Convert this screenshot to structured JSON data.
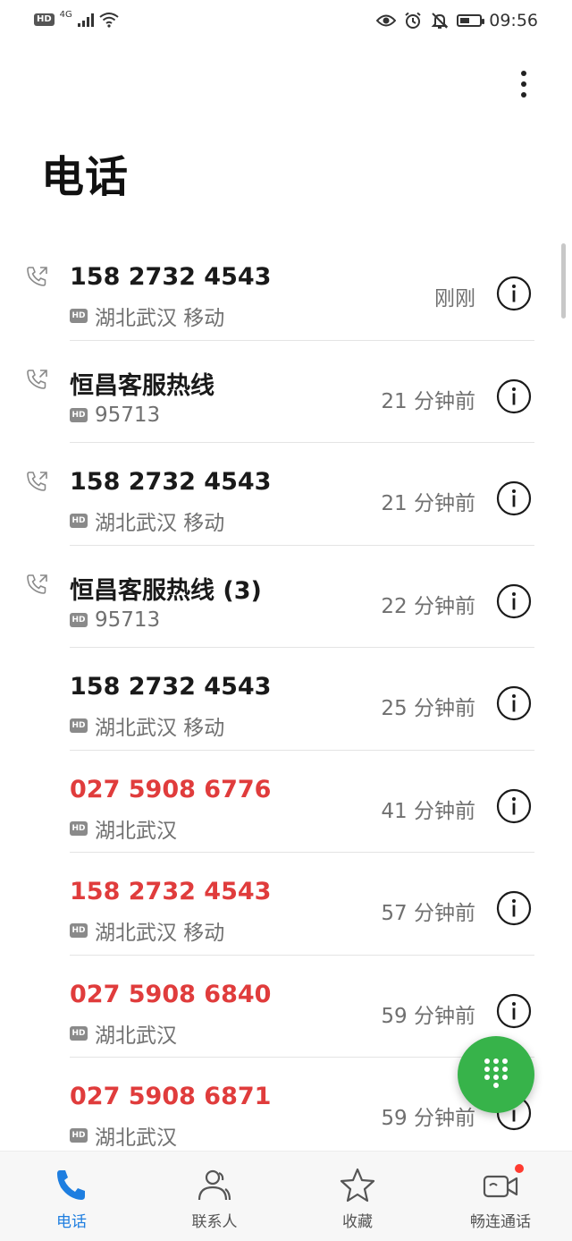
{
  "status_bar": {
    "hd": "HD",
    "network": "4G",
    "time": "09:56",
    "icons": [
      "eye-icon",
      "alarm-icon",
      "mute-icon",
      "battery-icon"
    ]
  },
  "header": {
    "title": "电话"
  },
  "calls": [
    {
      "name": "158 2732 4543",
      "hd": "HD",
      "subtitle": "湖北武汉 移动",
      "time": "刚刚",
      "type": "outgoing",
      "missed": false
    },
    {
      "name": "恒昌客服热线",
      "hd": "HD",
      "subtitle": "95713",
      "time": "21 分钟前",
      "type": "outgoing",
      "missed": false
    },
    {
      "name": "158 2732 4543",
      "hd": "HD",
      "subtitle": "湖北武汉 移动",
      "time": "21 分钟前",
      "type": "outgoing",
      "missed": false
    },
    {
      "name": "恒昌客服热线 (3)",
      "hd": "HD",
      "subtitle": "95713",
      "time": "22 分钟前",
      "type": "outgoing",
      "missed": false
    },
    {
      "name": "158 2732 4543",
      "hd": "HD",
      "subtitle": "湖北武汉 移动",
      "time": "25 分钟前",
      "type": "incoming",
      "missed": false
    },
    {
      "name": "027 5908 6776",
      "hd": "HD",
      "subtitle": "湖北武汉",
      "time": "41 分钟前",
      "type": "missed",
      "missed": true
    },
    {
      "name": "158 2732 4543",
      "hd": "HD",
      "subtitle": "湖北武汉 移动",
      "time": "57 分钟前",
      "type": "missed",
      "missed": true
    },
    {
      "name": "027 5908 6840",
      "hd": "HD",
      "subtitle": "湖北武汉",
      "time": "59 分钟前",
      "type": "missed",
      "missed": true
    },
    {
      "name": "027 5908 6871",
      "hd": "HD",
      "subtitle": "湖北武汉",
      "time": "59 分钟前",
      "type": "missed",
      "missed": true
    }
  ],
  "bottom_nav": {
    "items": [
      {
        "label": "电话",
        "icon": "phone-icon",
        "active": true
      },
      {
        "label": "联系人",
        "icon": "contacts-icon",
        "active": false
      },
      {
        "label": "收藏",
        "icon": "star-icon",
        "active": false
      },
      {
        "label": "畅连通话",
        "icon": "video-call-icon",
        "active": false
      }
    ]
  },
  "colors": {
    "accent": "#1e7ee0",
    "missed": "#e03c3c",
    "fab": "#37b34a",
    "notification_dot": "#ff3b30"
  }
}
